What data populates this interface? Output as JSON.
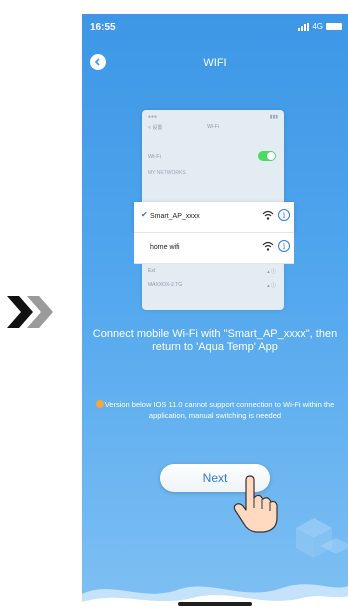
{
  "status_bar": {
    "time": "16:55",
    "network": "4G"
  },
  "header": {
    "title": "WIFI"
  },
  "screenshot": {
    "mini_back": "< 设置",
    "mini_title": "Wi-Fi",
    "wifi_label": "Wi-Fi",
    "section_label": "MY NETWORKS",
    "networks": [
      {
        "name": "Smart_AP_xxxx",
        "selected": true
      },
      {
        "name": "home wifi",
        "selected": false
      }
    ],
    "faded_rows": [
      "Ext",
      "MAXXOX-2.TG"
    ]
  },
  "instruction": "Connect mobile Wi-Fi with \"Smart_AP_xxxx\", then return to 'Aqua Temp' App",
  "note": "Version below IOS 11.0 cannot support connection to Wi-Fi within the application, manual switching is needed",
  "next_button": "Next",
  "colors": {
    "background_top": "#3d97e6",
    "background_bottom": "#7fc0f3",
    "button_text": "#2d79d3",
    "toggle_on": "#4cd964",
    "warning": "#f4a640"
  }
}
